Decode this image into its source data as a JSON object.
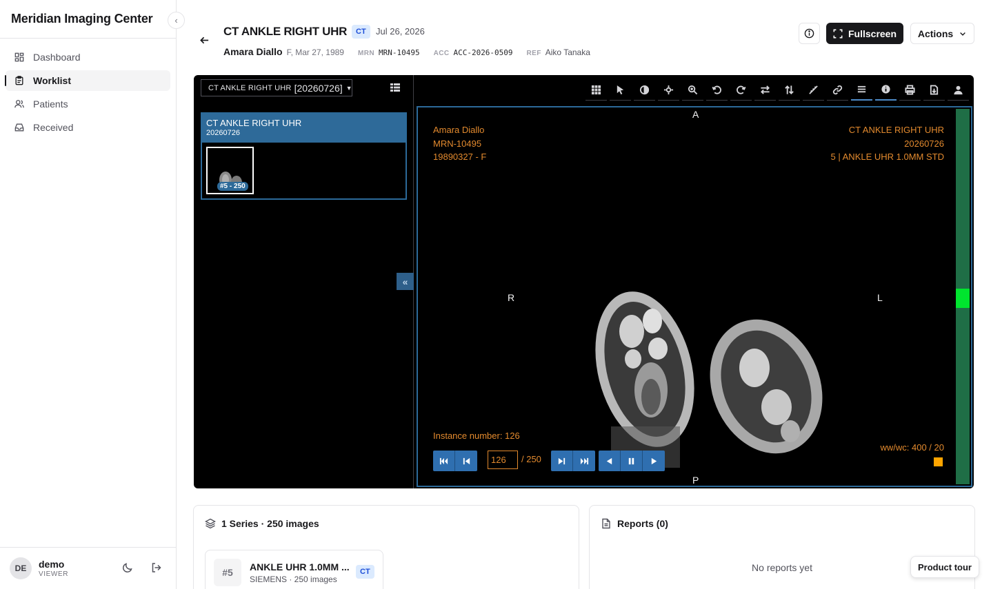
{
  "app": {
    "brand": "Meridian Imaging Center"
  },
  "sidebar": {
    "items": [
      {
        "label": "Dashboard",
        "icon": "dashboard-icon",
        "active": false
      },
      {
        "label": "Worklist",
        "icon": "clipboard-icon",
        "active": true
      },
      {
        "label": "Patients",
        "icon": "users-icon",
        "active": false
      },
      {
        "label": "Received",
        "icon": "inbox-icon",
        "active": false
      }
    ],
    "user": {
      "initials": "DE",
      "name": "demo",
      "role": "VIEWER"
    }
  },
  "header": {
    "title": "CT ANKLE RIGHT UHR",
    "modality": "CT",
    "date": "Jul 26, 2026",
    "patient_name": "Amara Diallo",
    "patient_demo": "F, Mar 27, 1989",
    "mrn_label": "MRN",
    "mrn": "MRN-10495",
    "acc_label": "ACC",
    "acc": "ACC-2026-0509",
    "ref_label": "REF",
    "ref": "Aiko Tanaka",
    "fullscreen_label": "Fullscreen",
    "actions_label": "Actions"
  },
  "viewer": {
    "study_select": {
      "prefix": "CT ANKLE RIGHT UHR",
      "date": "[20260726]"
    },
    "series_card": {
      "title": "CT ANKLE RIGHT UHR",
      "date": "20260726",
      "thumb_badge": "#5 - 250"
    },
    "tools": [
      "layout-grid-icon",
      "pointer-icon",
      "contrast-icon",
      "pan-icon",
      "zoom-icon",
      "rotate-left-icon",
      "rotate-right-icon",
      "flip-horizontal-icon",
      "flip-vertical-icon",
      "measure-icon",
      "link-icon",
      "menu-icon",
      "info-icon",
      "print-icon",
      "download-icon",
      "user-icon"
    ],
    "overlay": {
      "top_left": [
        "Amara Diallo",
        "MRN-10495",
        "19890327 - F"
      ],
      "top_right": [
        "CT ANKLE RIGHT UHR",
        "20260726",
        "5 | ANKLE UHR 1.0MM STD"
      ],
      "instance": "Instance number: 126",
      "wwwc": "ww/wc: 400 / 20"
    },
    "orientation": {
      "top": "A",
      "bottom": "P",
      "left": "R",
      "right": "L"
    },
    "frame": {
      "current": "126",
      "total": "/ 250",
      "scroll_fraction": 0.504
    },
    "colors": {
      "overlay": "#e38a2e",
      "accent": "#2e6a99",
      "scrollbar": "#1f6e46",
      "scroll_thumb": "#00e52e"
    }
  },
  "series_panel": {
    "title": "1 Series · 250 images",
    "items": [
      {
        "number": "#5",
        "description": "ANKLE UHR 1.0MM ...",
        "sub": "SIEMENS · 250 images",
        "modality": "CT"
      }
    ]
  },
  "reports_panel": {
    "title": "Reports (0)",
    "empty": "No reports yet"
  },
  "product_tour": "Product tour"
}
